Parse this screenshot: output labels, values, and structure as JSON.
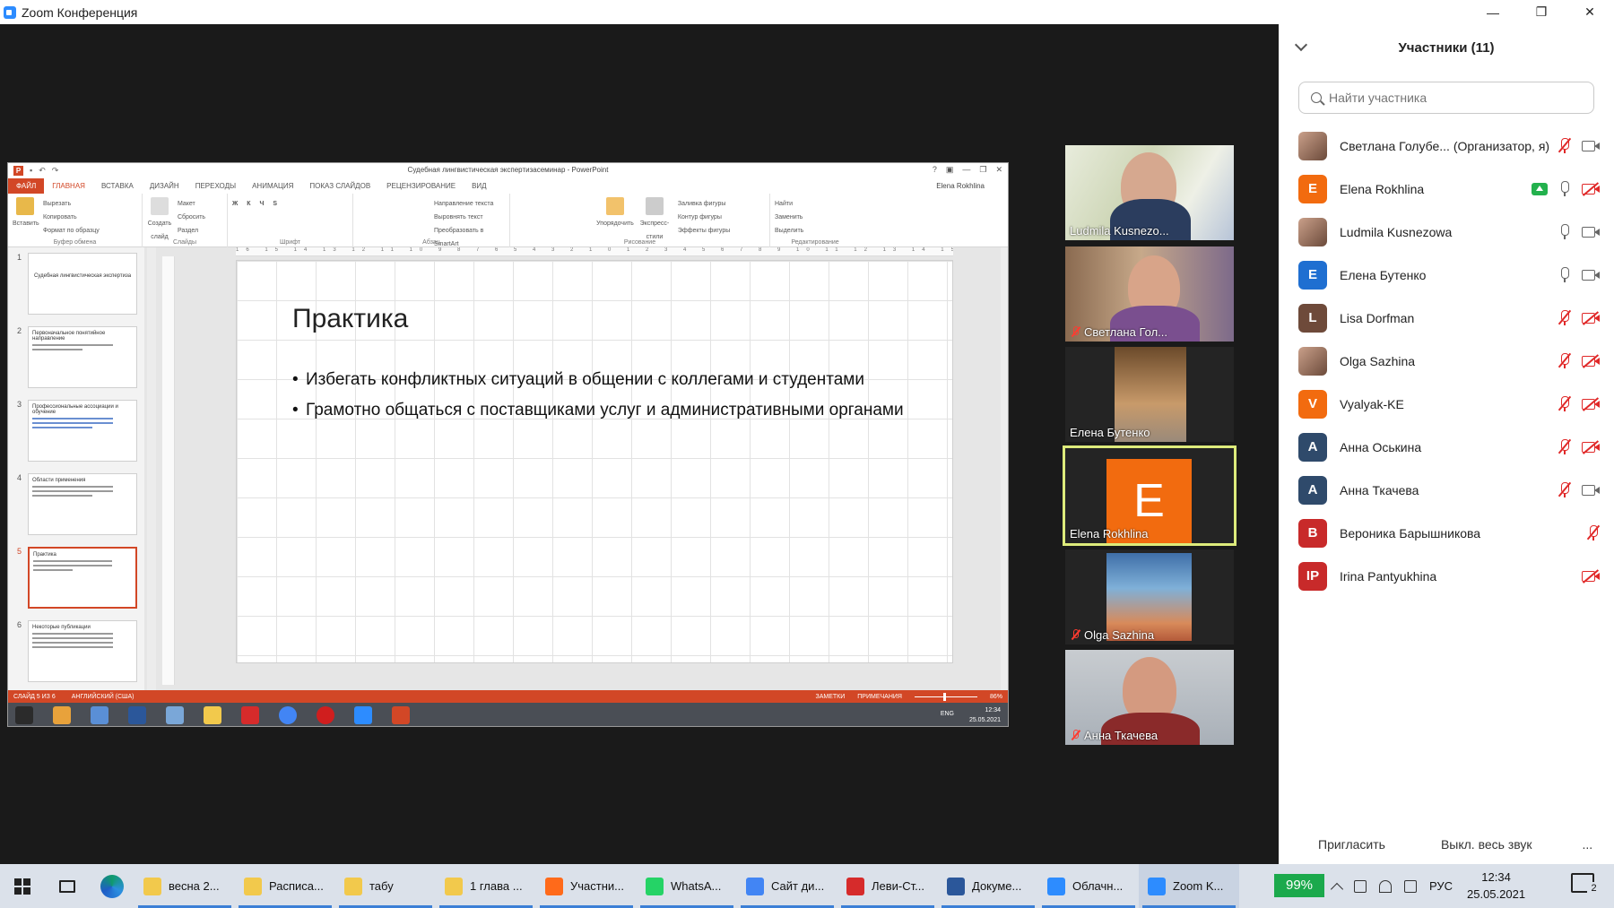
{
  "window": {
    "title": "Zoom Конференция",
    "minimize": "—",
    "maximize": "❐",
    "close": "✕"
  },
  "ppt": {
    "doc_title": "Судебная лингвистическая экспертизасеминар - PowerPoint",
    "title_controls": [
      "?",
      "▣",
      "—",
      "❐",
      "✕"
    ],
    "tabs": [
      "ФАЙЛ",
      "ГЛАВНАЯ",
      "ВСТАВКА",
      "ДИЗАЙН",
      "ПЕРЕХОДЫ",
      "АНИМАЦИЯ",
      "ПОКАЗ СЛАЙДОВ",
      "РЕЦЕНЗИРОВАНИЕ",
      "ВИД"
    ],
    "user": "Elena Rokhlina",
    "ribbon": {
      "clipboard": {
        "paste": "Вставить",
        "cut": "Вырезать",
        "copy": "Копировать",
        "format": "Формат по образцу",
        "label": "Буфер обмена"
      },
      "slides": {
        "create": "Создать слайд",
        "layout": "Макет",
        "reset": "Сбросить",
        "section": "Раздел",
        "label": "Слайды"
      },
      "font": {
        "label": "Шрифт"
      },
      "paragraph": {
        "dir": "Направление текста",
        "align": "Выровнять текст",
        "smartart": "Преобразовать в SmartArt",
        "label": "Абзац"
      },
      "drawing": {
        "arrange": "Упорядочить",
        "styles": "Экспресс-стили",
        "fill": "Заливка фигуры",
        "outline": "Контур фигуры",
        "effects": "Эффекты фигуры",
        "label": "Рисование"
      },
      "editing": {
        "find": "Найти",
        "replace": "Заменить",
        "select": "Выделить",
        "label": "Редактирование"
      }
    },
    "ruler_h": "16 15 14 13 12 11 10 9 8 7 6 5 4 3 2 1 0 1 2 3 4 5 6 7 8 9 10 11 12 13 14 15 16",
    "thumbnails": [
      {
        "num": "1",
        "title": "Судебная лингвистическая экспертиза"
      },
      {
        "num": "2",
        "title": "Первоначальное понятийное направление"
      },
      {
        "num": "3",
        "title": "Профессиональные ассоциации и обучение"
      },
      {
        "num": "4",
        "title": "Области применения"
      },
      {
        "num": "5",
        "title": "Практика"
      },
      {
        "num": "6",
        "title": "Некоторые публикации"
      }
    ],
    "slide": {
      "title": "Практика",
      "bullets": [
        "Избегать конфликтных ситуаций в общении с коллегами и студентами",
        "Грамотно общаться с поставщиками услуг и административными органами"
      ]
    },
    "status": {
      "slide": "СЛАЙД 5 ИЗ 6",
      "language": "АНГЛИЙСКИЙ (США)",
      "notes": "ЗАМЕТКИ",
      "comments": "ПРИМЕЧАНИЯ",
      "zoom": "86%"
    },
    "inner_clock": {
      "lang": "ENG",
      "time": "12:34",
      "date": "25.05.2021"
    }
  },
  "tiles": [
    {
      "name": "Ludmila Kusnezo...",
      "muted": false
    },
    {
      "name": "Светлана Гол...",
      "muted": true
    },
    {
      "name": "Елена Бутенко",
      "muted": false
    },
    {
      "name": "Elena Rokhlina",
      "muted": false,
      "initial": "E"
    },
    {
      "name": "Olga Sazhina",
      "muted": true
    },
    {
      "name": "Анна Ткачева",
      "muted": true
    }
  ],
  "panel": {
    "title": "Участники (11)",
    "search_placeholder": "Найти участника",
    "participants": [
      {
        "name": "Светлана Голубе... (Организатор, я)",
        "initial": "",
        "color": "#8b5a4a",
        "mic": "muted",
        "cam": "on",
        "share": false
      },
      {
        "name": "Elena Rokhlina",
        "initial": "E",
        "color": "#f26b0f",
        "mic": "on",
        "cam": "off",
        "share": true
      },
      {
        "name": "Ludmila Kusnezowa",
        "initial": "",
        "color": "#6b6f78",
        "mic": "on",
        "cam": "on",
        "share": false
      },
      {
        "name": "Елена Бутенко",
        "initial": "E",
        "color": "#1f6fd1",
        "mic": "on",
        "cam": "on",
        "share": false
      },
      {
        "name": "Lisa Dorfman",
        "initial": "L",
        "color": "#6e4a3a",
        "mic": "muted",
        "cam": "off",
        "share": false
      },
      {
        "name": "Olga Sazhina",
        "initial": "",
        "color": "#3b6f8f",
        "mic": "muted",
        "cam": "off",
        "share": false
      },
      {
        "name": "Vyalyak-KE",
        "initial": "V",
        "color": "#f26b0f",
        "mic": "muted",
        "cam": "off",
        "share": false
      },
      {
        "name": "Анна Оськина",
        "initial": "A",
        "color": "#2f4a6b",
        "mic": "muted",
        "cam": "off",
        "share": false
      },
      {
        "name": "Анна Ткачева",
        "initial": "A",
        "color": "#2f4a6b",
        "mic": "muted",
        "cam": "on",
        "share": false
      },
      {
        "name": "Вероника Барышникова",
        "initial": "B",
        "color": "#c82a2a",
        "mic": "muted",
        "cam": "none",
        "share": false
      },
      {
        "name": "Irina Pantyukhina",
        "initial": "IP",
        "color": "#c82a2a",
        "mic": "none",
        "cam": "off",
        "share": false
      }
    ],
    "invite": "Пригласить",
    "mute_all": "Выкл. весь звук",
    "more": "..."
  },
  "taskbar": {
    "items": [
      {
        "label": "весна 2...",
        "color": "#f2c94c"
      },
      {
        "label": "Расписа...",
        "color": "#f2c94c"
      },
      {
        "label": "табу",
        "color": "#f2c94c"
      },
      {
        "label": "1 глава ...",
        "color": "#f2c94c"
      },
      {
        "label": "Участни...",
        "color": "#ff6a1a"
      },
      {
        "label": "WhatsA...",
        "color": "#25d366"
      },
      {
        "label": "Сайт ди...",
        "color": "#4285f4"
      },
      {
        "label": "Леви-Ст...",
        "color": "#d62b2b"
      },
      {
        "label": "Докуме...",
        "color": "#2b579a"
      },
      {
        "label": "Облачн...",
        "color": "#2d8cff"
      },
      {
        "label": "Zoom K...",
        "color": "#2d8cff"
      }
    ],
    "battery": "99%",
    "lang": "РУС",
    "time": "12:34",
    "date": "25.05.2021",
    "notifications": "2"
  }
}
